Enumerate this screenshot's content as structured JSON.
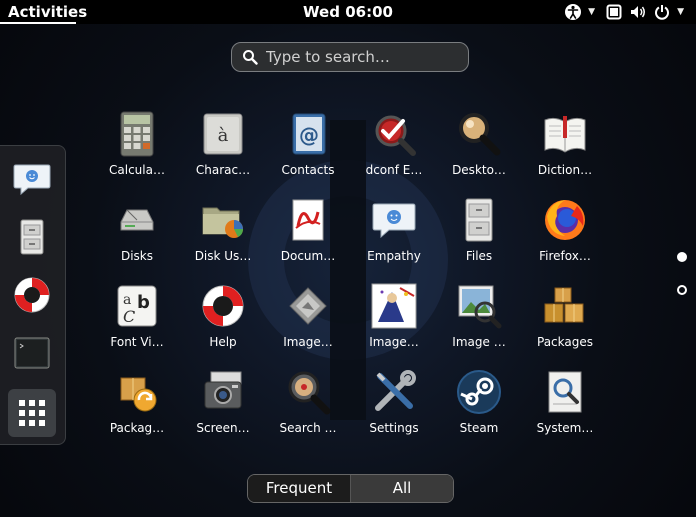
{
  "topbar": {
    "activities": "Activities",
    "clock": "Wed 06:00"
  },
  "search": {
    "placeholder": "Type to search…"
  },
  "dash": {
    "items": [
      "empathy-icon",
      "files-icon",
      "help-icon",
      "terminal-icon",
      "show-apps-icon"
    ]
  },
  "apps": [
    {
      "label": "Calcula…",
      "icon": "calculator-icon"
    },
    {
      "label": "Charac…",
      "icon": "characters-icon"
    },
    {
      "label": "Contacts",
      "icon": "contacts-icon"
    },
    {
      "label": "dconf E…",
      "icon": "dconf-editor-icon"
    },
    {
      "label": "Deskto…",
      "icon": "desktop-search-icon"
    },
    {
      "label": "Diction…",
      "icon": "dictionary-icon"
    },
    {
      "label": "Disks",
      "icon": "disks-icon"
    },
    {
      "label": "Disk Us…",
      "icon": "disk-usage-icon"
    },
    {
      "label": "Docum…",
      "icon": "document-viewer-icon"
    },
    {
      "label": "Empathy",
      "icon": "empathy-icon"
    },
    {
      "label": "Files",
      "icon": "files-icon"
    },
    {
      "label": "Firefox…",
      "icon": "firefox-icon"
    },
    {
      "label": "Font Vi…",
      "icon": "font-viewer-icon"
    },
    {
      "label": "Help",
      "icon": "help-icon"
    },
    {
      "label": "Image…",
      "icon": "image-viewer-icon"
    },
    {
      "label": "Image…",
      "icon": "gimp-icon"
    },
    {
      "label": "Image …",
      "icon": "image-browser-icon"
    },
    {
      "label": "Packages",
      "icon": "packages-icon"
    },
    {
      "label": "Packag…",
      "icon": "package-updater-icon"
    },
    {
      "label": "Screen…",
      "icon": "screenshot-icon"
    },
    {
      "label": "Search …",
      "icon": "search-tool-icon"
    },
    {
      "label": "Settings",
      "icon": "settings-icon"
    },
    {
      "label": "Steam",
      "icon": "steam-icon"
    },
    {
      "label": "System…",
      "icon": "system-monitor-icon"
    }
  ],
  "toggle": {
    "frequent": "Frequent",
    "all": "All"
  },
  "colors": {
    "panel": "#000000",
    "toggle_selected": "#3a3a3a",
    "toggle_unselected": "#1c1c1c"
  }
}
